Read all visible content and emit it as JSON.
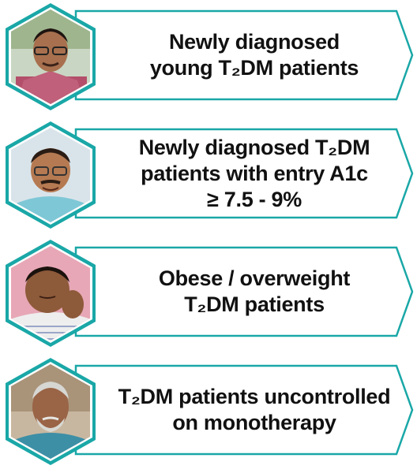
{
  "cards": [
    {
      "lines": [
        "Newly diagnosed",
        "young T₂DM patients"
      ],
      "avatar": "young-man-with-glasses"
    },
    {
      "lines": [
        "Newly diagnosed T₂DM",
        "patients with entry A1c",
        "≥ 7.5 - 9%"
      ],
      "avatar": "middle-aged-man-with-glasses"
    },
    {
      "lines": [
        "Obese / overweight",
        "T₂DM patients"
      ],
      "avatar": "overweight-man-resting-head"
    },
    {
      "lines": [
        "T₂DM patients uncontrolled",
        "on monotherapy"
      ],
      "avatar": "older-man-grey-beard"
    }
  ],
  "colors": {
    "accent": "#1aa7a7",
    "accent_light": "#7fd3d3",
    "text": "#111111"
  }
}
